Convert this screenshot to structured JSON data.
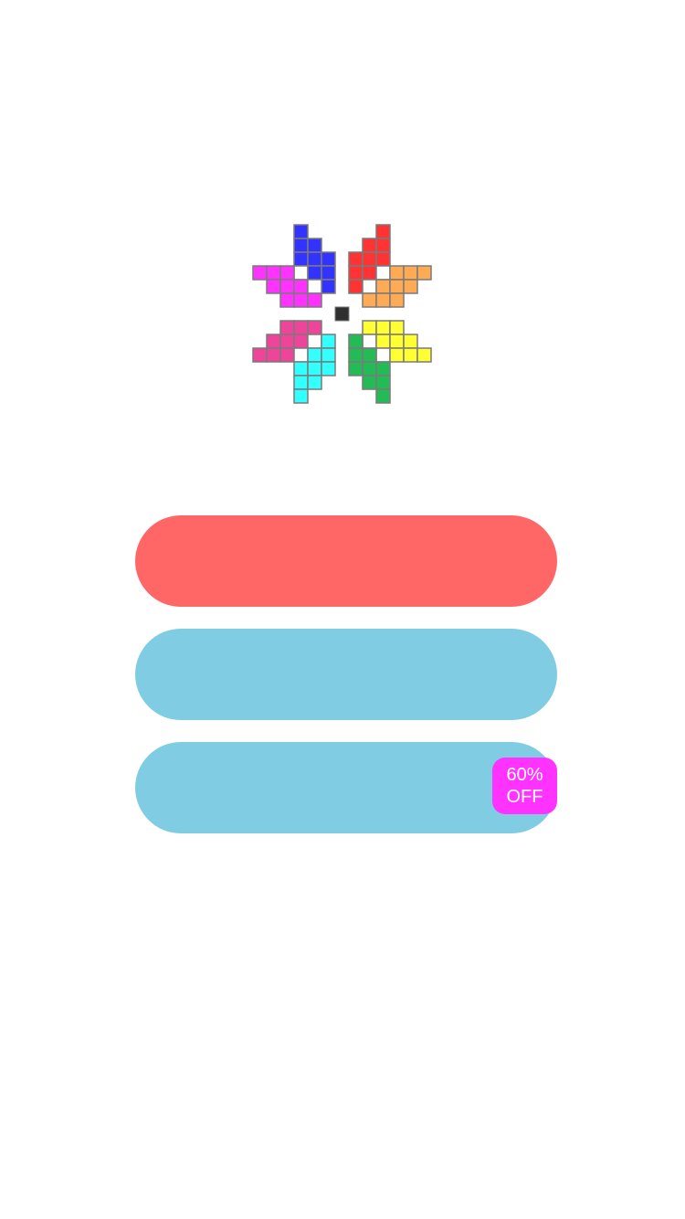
{
  "colors": {
    "background": "#ffffff",
    "cell_border": "#7a7a7a",
    "center_square": "#2f2f2f",
    "blue": "#3333ff",
    "red": "#ff3333",
    "orange": "#ffaa55",
    "magenta": "#ff33ff",
    "pink": "#ee4499",
    "cyan": "#33ffff",
    "green": "#22bb55",
    "yellow": "#ffff33",
    "empty_cell": "#ffffff"
  },
  "logo": {
    "shape_colors": [
      "blue",
      "red",
      "magenta",
      "orange",
      "pink",
      "yellow",
      "cyan",
      "green"
    ]
  },
  "menu": {
    "buttons": [
      {
        "name": "primary-button",
        "label": "",
        "color": "#ff6666"
      },
      {
        "name": "secondary-button",
        "label": "",
        "color": "#80cce3"
      },
      {
        "name": "sale-button",
        "label": "",
        "color": "#80cce3"
      }
    ],
    "badge": {
      "line1": "60%",
      "line2": "OFF",
      "color": "#ff33ff"
    }
  }
}
